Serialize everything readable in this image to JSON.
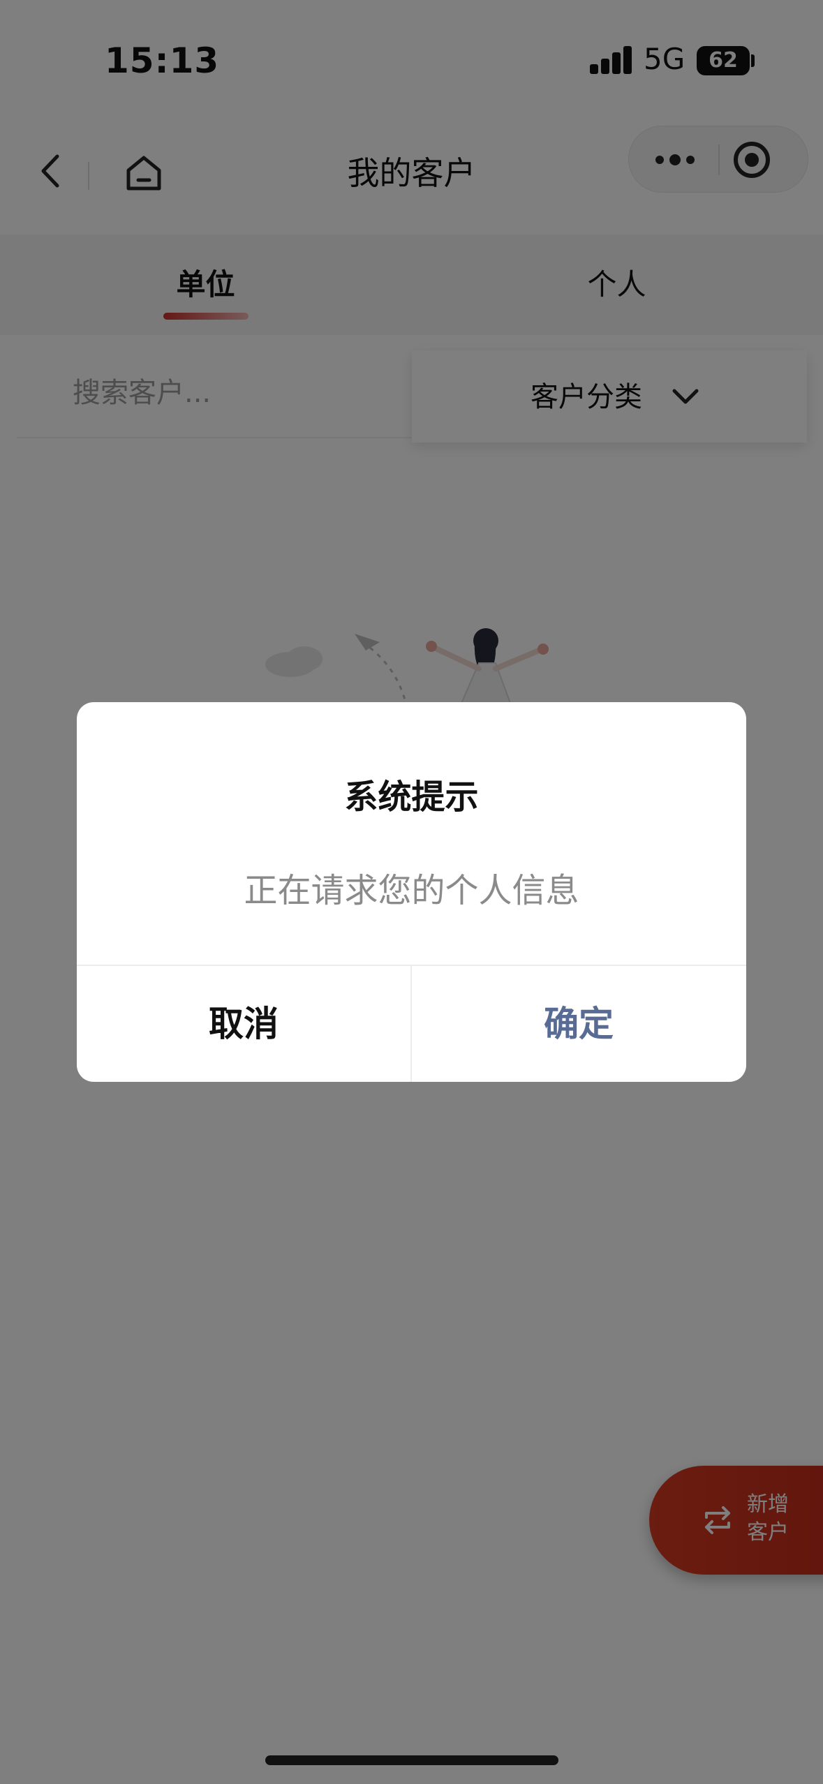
{
  "status_bar": {
    "time": "15:13",
    "network": "5G",
    "battery": "62"
  },
  "nav": {
    "title": "我的客户"
  },
  "tabs": [
    {
      "label": "单位",
      "active": true
    },
    {
      "label": "个人",
      "active": false
    }
  ],
  "search": {
    "placeholder": "搜索客户...",
    "value": ""
  },
  "filter": {
    "label": "客户分类"
  },
  "fab": {
    "label": "新增客户"
  },
  "dialog": {
    "title": "系统提示",
    "message": "正在请求您的个人信息",
    "cancel_label": "取消",
    "confirm_label": "确定"
  },
  "colors": {
    "accent": "#c9302c",
    "confirm": "#576b95",
    "overlay": "rgba(0,0,0,0.5)"
  },
  "icons": [
    "back-icon",
    "home-icon",
    "more-icon",
    "close-target-icon",
    "chevron-down-icon",
    "swap-icon"
  ]
}
